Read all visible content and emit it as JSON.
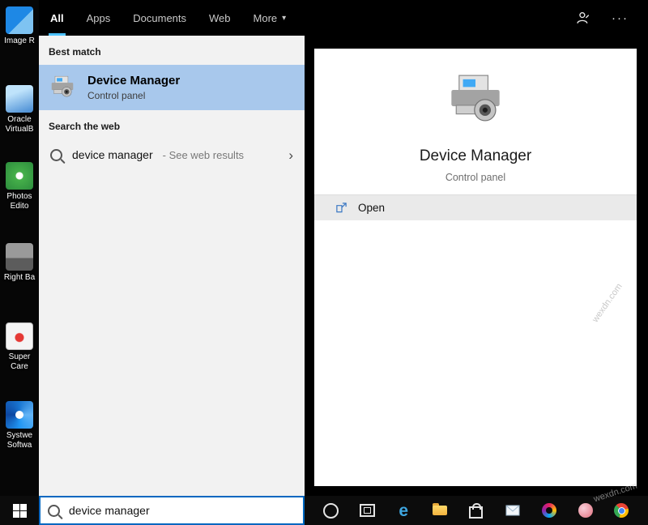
{
  "topbar": {
    "tabs": [
      {
        "label": "All",
        "active": true
      },
      {
        "label": "Apps",
        "active": false
      },
      {
        "label": "Documents",
        "active": false
      },
      {
        "label": "Web",
        "active": false
      },
      {
        "label": "More",
        "active": false,
        "has_dropdown": true
      }
    ],
    "caret_glyph": "▾",
    "ellipsis_glyph": "···"
  },
  "search_panel": {
    "best_match_header": "Best match",
    "best_match": {
      "title": "Device Manager",
      "subtitle": "Control panel",
      "icon": "device-manager-icon"
    },
    "web_header": "Search the web",
    "web_result": {
      "query": "device manager",
      "suffix": " - See web results",
      "icon": "search-icon",
      "chevron_glyph": "›"
    }
  },
  "preview": {
    "title": "Device Manager",
    "subtitle": "Control panel",
    "open_label": "Open",
    "icon": "device-manager-icon"
  },
  "taskbar": {
    "search_value": "device manager",
    "icons": [
      "start",
      "cortana",
      "task-view",
      "edge",
      "file-explorer",
      "store",
      "mail",
      "paint-3d",
      "pink-app",
      "chrome"
    ]
  },
  "desktop_icons": [
    {
      "line1": "Image R",
      "line2": ""
    },
    {
      "line1": "Oracle",
      "line2": "VirtualB"
    },
    {
      "line1": "Photos",
      "line2": "Edito"
    },
    {
      "line1": "Right Ba",
      "line2": ""
    },
    {
      "line1": "Super",
      "line2": "Care"
    },
    {
      "line1": "Systwe",
      "line2": "Softwa"
    }
  ],
  "watermark": "wexdn.com",
  "colors": {
    "accent": "#0067c0",
    "tab_underline": "#4cc2ff",
    "best_match_highlight": "#a8c8ec",
    "panel_bg": "#f2f2f2",
    "taskbar_bg": "#0c0c0c"
  }
}
